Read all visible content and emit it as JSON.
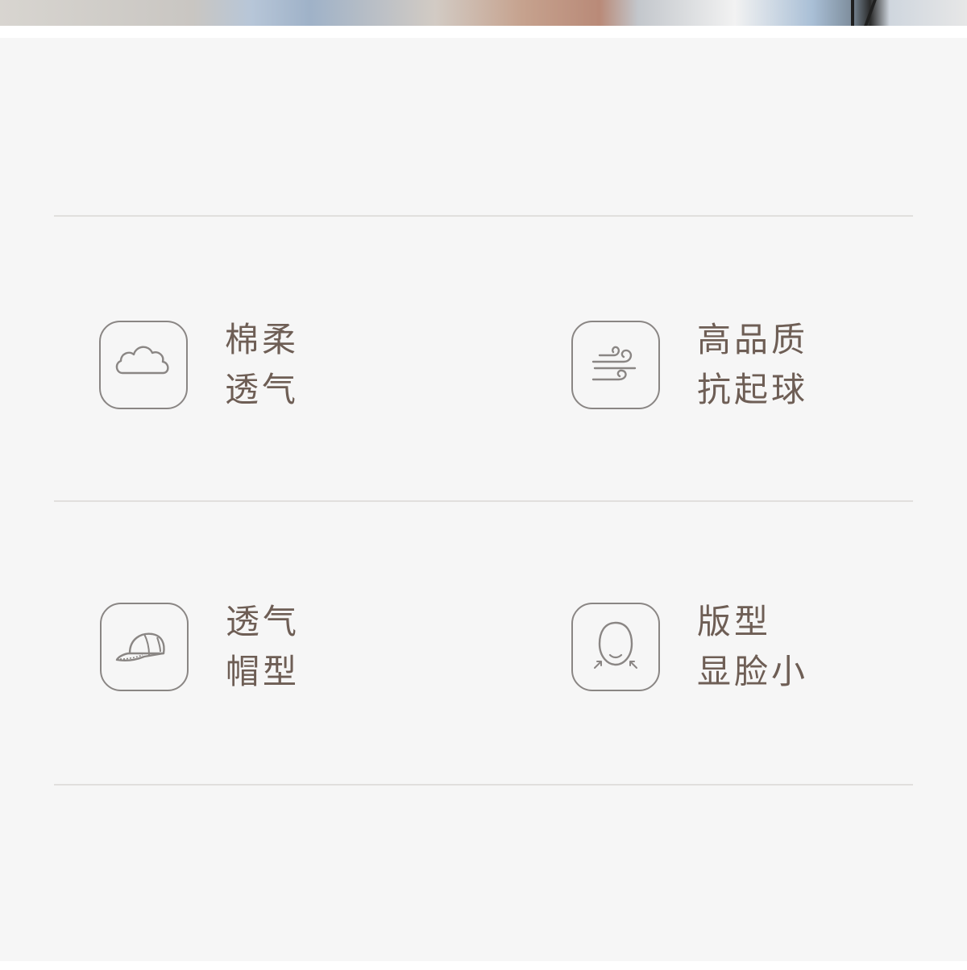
{
  "features": [
    {
      "icon": "cloud-icon",
      "line1": "棉柔",
      "line2": "透气"
    },
    {
      "icon": "wind-icon",
      "line1": "高品质",
      "line2": "抗起球"
    },
    {
      "icon": "cap-icon",
      "line1": "透气",
      "line2": "帽型"
    },
    {
      "icon": "face-icon",
      "line1": "版型",
      "line2": "显脸小"
    }
  ],
  "colors": {
    "text": "#6e5e55",
    "icon_stroke": "#8a8684",
    "background": "#f6f6f6",
    "divider": "#e1dfdd"
  }
}
